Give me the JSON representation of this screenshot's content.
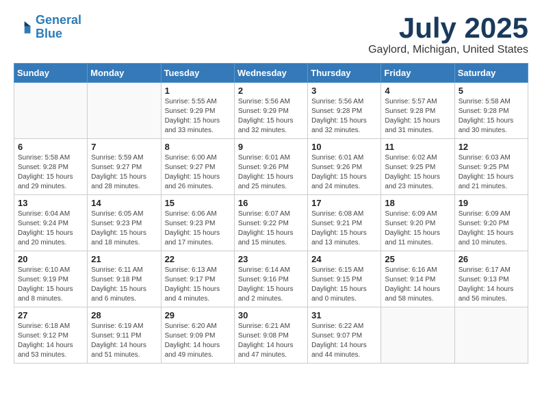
{
  "logo": {
    "line1": "General",
    "line2": "Blue"
  },
  "title": "July 2025",
  "location": "Gaylord, Michigan, United States",
  "days_of_week": [
    "Sunday",
    "Monday",
    "Tuesday",
    "Wednesday",
    "Thursday",
    "Friday",
    "Saturday"
  ],
  "weeks": [
    [
      {
        "day": "",
        "info": ""
      },
      {
        "day": "",
        "info": ""
      },
      {
        "day": "1",
        "info": "Sunrise: 5:55 AM\nSunset: 9:29 PM\nDaylight: 15 hours and 33 minutes."
      },
      {
        "day": "2",
        "info": "Sunrise: 5:56 AM\nSunset: 9:29 PM\nDaylight: 15 hours and 32 minutes."
      },
      {
        "day": "3",
        "info": "Sunrise: 5:56 AM\nSunset: 9:28 PM\nDaylight: 15 hours and 32 minutes."
      },
      {
        "day": "4",
        "info": "Sunrise: 5:57 AM\nSunset: 9:28 PM\nDaylight: 15 hours and 31 minutes."
      },
      {
        "day": "5",
        "info": "Sunrise: 5:58 AM\nSunset: 9:28 PM\nDaylight: 15 hours and 30 minutes."
      }
    ],
    [
      {
        "day": "6",
        "info": "Sunrise: 5:58 AM\nSunset: 9:28 PM\nDaylight: 15 hours and 29 minutes."
      },
      {
        "day": "7",
        "info": "Sunrise: 5:59 AM\nSunset: 9:27 PM\nDaylight: 15 hours and 28 minutes."
      },
      {
        "day": "8",
        "info": "Sunrise: 6:00 AM\nSunset: 9:27 PM\nDaylight: 15 hours and 26 minutes."
      },
      {
        "day": "9",
        "info": "Sunrise: 6:01 AM\nSunset: 9:26 PM\nDaylight: 15 hours and 25 minutes."
      },
      {
        "day": "10",
        "info": "Sunrise: 6:01 AM\nSunset: 9:26 PM\nDaylight: 15 hours and 24 minutes."
      },
      {
        "day": "11",
        "info": "Sunrise: 6:02 AM\nSunset: 9:25 PM\nDaylight: 15 hours and 23 minutes."
      },
      {
        "day": "12",
        "info": "Sunrise: 6:03 AM\nSunset: 9:25 PM\nDaylight: 15 hours and 21 minutes."
      }
    ],
    [
      {
        "day": "13",
        "info": "Sunrise: 6:04 AM\nSunset: 9:24 PM\nDaylight: 15 hours and 20 minutes."
      },
      {
        "day": "14",
        "info": "Sunrise: 6:05 AM\nSunset: 9:23 PM\nDaylight: 15 hours and 18 minutes."
      },
      {
        "day": "15",
        "info": "Sunrise: 6:06 AM\nSunset: 9:23 PM\nDaylight: 15 hours and 17 minutes."
      },
      {
        "day": "16",
        "info": "Sunrise: 6:07 AM\nSunset: 9:22 PM\nDaylight: 15 hours and 15 minutes."
      },
      {
        "day": "17",
        "info": "Sunrise: 6:08 AM\nSunset: 9:21 PM\nDaylight: 15 hours and 13 minutes."
      },
      {
        "day": "18",
        "info": "Sunrise: 6:09 AM\nSunset: 9:20 PM\nDaylight: 15 hours and 11 minutes."
      },
      {
        "day": "19",
        "info": "Sunrise: 6:09 AM\nSunset: 9:20 PM\nDaylight: 15 hours and 10 minutes."
      }
    ],
    [
      {
        "day": "20",
        "info": "Sunrise: 6:10 AM\nSunset: 9:19 PM\nDaylight: 15 hours and 8 minutes."
      },
      {
        "day": "21",
        "info": "Sunrise: 6:11 AM\nSunset: 9:18 PM\nDaylight: 15 hours and 6 minutes."
      },
      {
        "day": "22",
        "info": "Sunrise: 6:13 AM\nSunset: 9:17 PM\nDaylight: 15 hours and 4 minutes."
      },
      {
        "day": "23",
        "info": "Sunrise: 6:14 AM\nSunset: 9:16 PM\nDaylight: 15 hours and 2 minutes."
      },
      {
        "day": "24",
        "info": "Sunrise: 6:15 AM\nSunset: 9:15 PM\nDaylight: 15 hours and 0 minutes."
      },
      {
        "day": "25",
        "info": "Sunrise: 6:16 AM\nSunset: 9:14 PM\nDaylight: 14 hours and 58 minutes."
      },
      {
        "day": "26",
        "info": "Sunrise: 6:17 AM\nSunset: 9:13 PM\nDaylight: 14 hours and 56 minutes."
      }
    ],
    [
      {
        "day": "27",
        "info": "Sunrise: 6:18 AM\nSunset: 9:12 PM\nDaylight: 14 hours and 53 minutes."
      },
      {
        "day": "28",
        "info": "Sunrise: 6:19 AM\nSunset: 9:11 PM\nDaylight: 14 hours and 51 minutes."
      },
      {
        "day": "29",
        "info": "Sunrise: 6:20 AM\nSunset: 9:09 PM\nDaylight: 14 hours and 49 minutes."
      },
      {
        "day": "30",
        "info": "Sunrise: 6:21 AM\nSunset: 9:08 PM\nDaylight: 14 hours and 47 minutes."
      },
      {
        "day": "31",
        "info": "Sunrise: 6:22 AM\nSunset: 9:07 PM\nDaylight: 14 hours and 44 minutes."
      },
      {
        "day": "",
        "info": ""
      },
      {
        "day": "",
        "info": ""
      }
    ]
  ]
}
